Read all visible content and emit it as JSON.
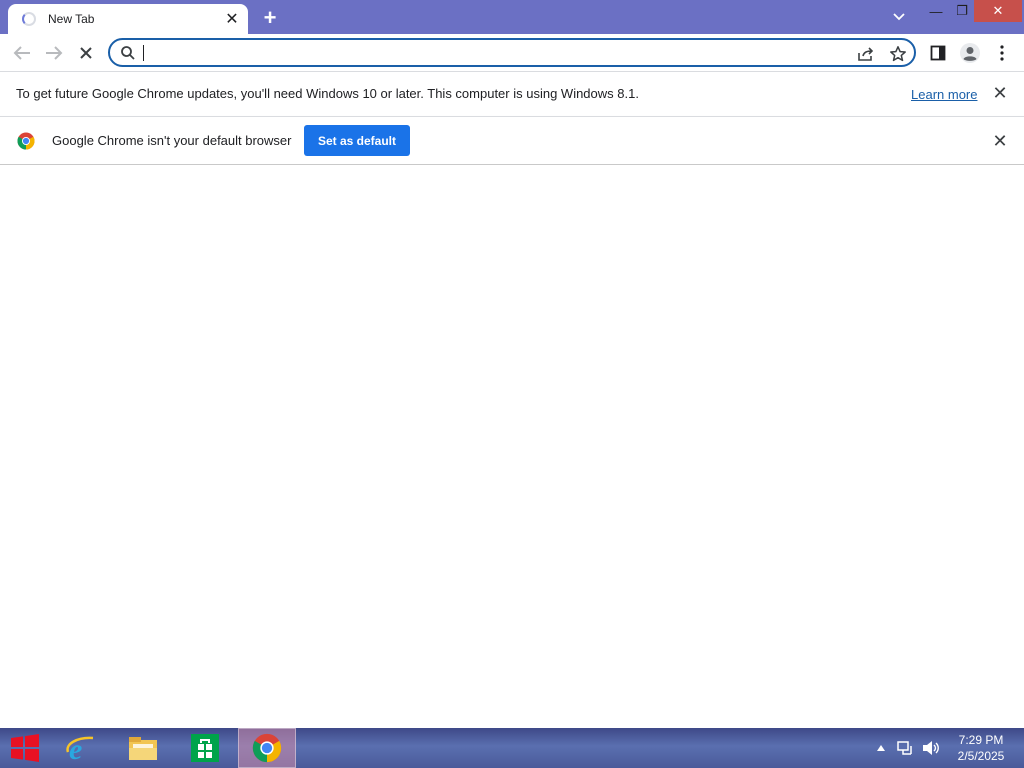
{
  "tab": {
    "title": "New Tab",
    "close_glyph": "✕",
    "new_tab_glyph": "+"
  },
  "window_controls": {
    "minimize": "—",
    "maximize": "❐",
    "close": "✕"
  },
  "omnibox": {
    "value": "",
    "placeholder": ""
  },
  "update_bar": {
    "message": "To get future Google Chrome updates, you'll need Windows 10 or later. This computer is using Windows 8.1.",
    "link": "Learn more",
    "close_glyph": "✕"
  },
  "default_bar": {
    "message": "Google Chrome isn't your default browser",
    "button": "Set as default",
    "close_glyph": "✕"
  },
  "taskbar": {
    "items": [
      "windows-start",
      "internet-explorer",
      "file-explorer",
      "windows-store",
      "google-chrome"
    ],
    "clock_time": "7:29 PM",
    "clock_date": "2/5/2025"
  },
  "colors": {
    "titlebar": "#6b70c4",
    "omnibox_border": "#1a5fa8",
    "set_default_button": "#1a73e8",
    "link": "#1a5fa8",
    "window_close": "#c7504b"
  },
  "icons": [
    "tab-spinner-icon",
    "tab-search-icon",
    "back-arrow-icon",
    "forward-arrow-icon",
    "stop-loading-icon",
    "search-icon",
    "share-icon",
    "bookmark-star-icon",
    "side-panel-icon",
    "profile-icon",
    "kebab-menu-icon",
    "chrome-logo-icon"
  ]
}
